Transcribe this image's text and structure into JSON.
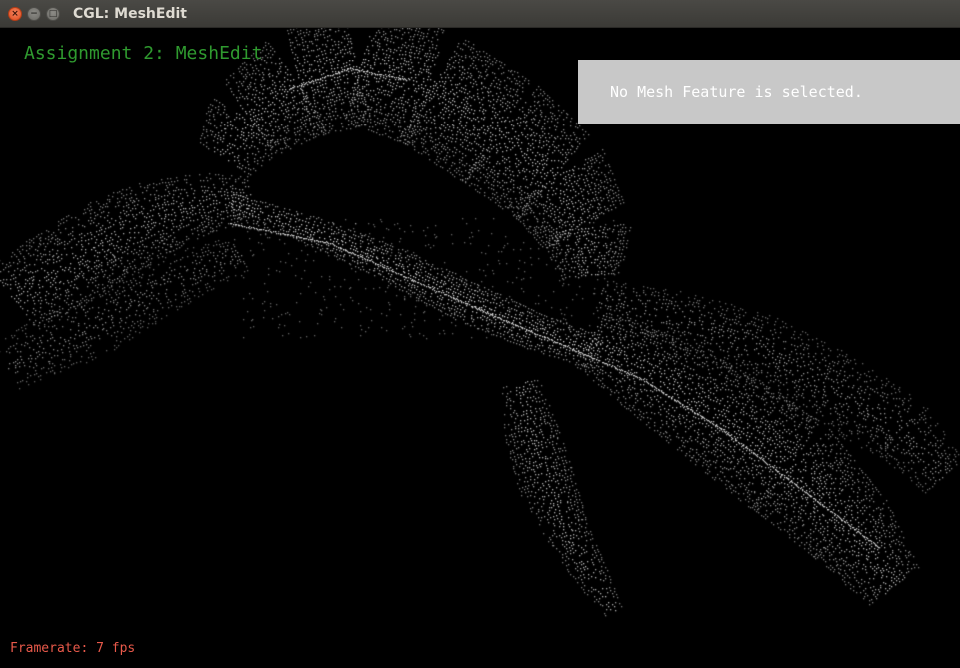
{
  "window": {
    "title": "CGL: MeshEdit",
    "close_glyph": "×",
    "minimize_glyph": "−",
    "maximize_glyph": "□"
  },
  "viewport": {
    "heading": "Assignment 2: MeshEdit",
    "info_panel_text": "No Mesh Feature is selected.",
    "framerate_text": "Framerate: 7 fps",
    "point_color": "#d8d8d8",
    "background_color": "#000000"
  }
}
